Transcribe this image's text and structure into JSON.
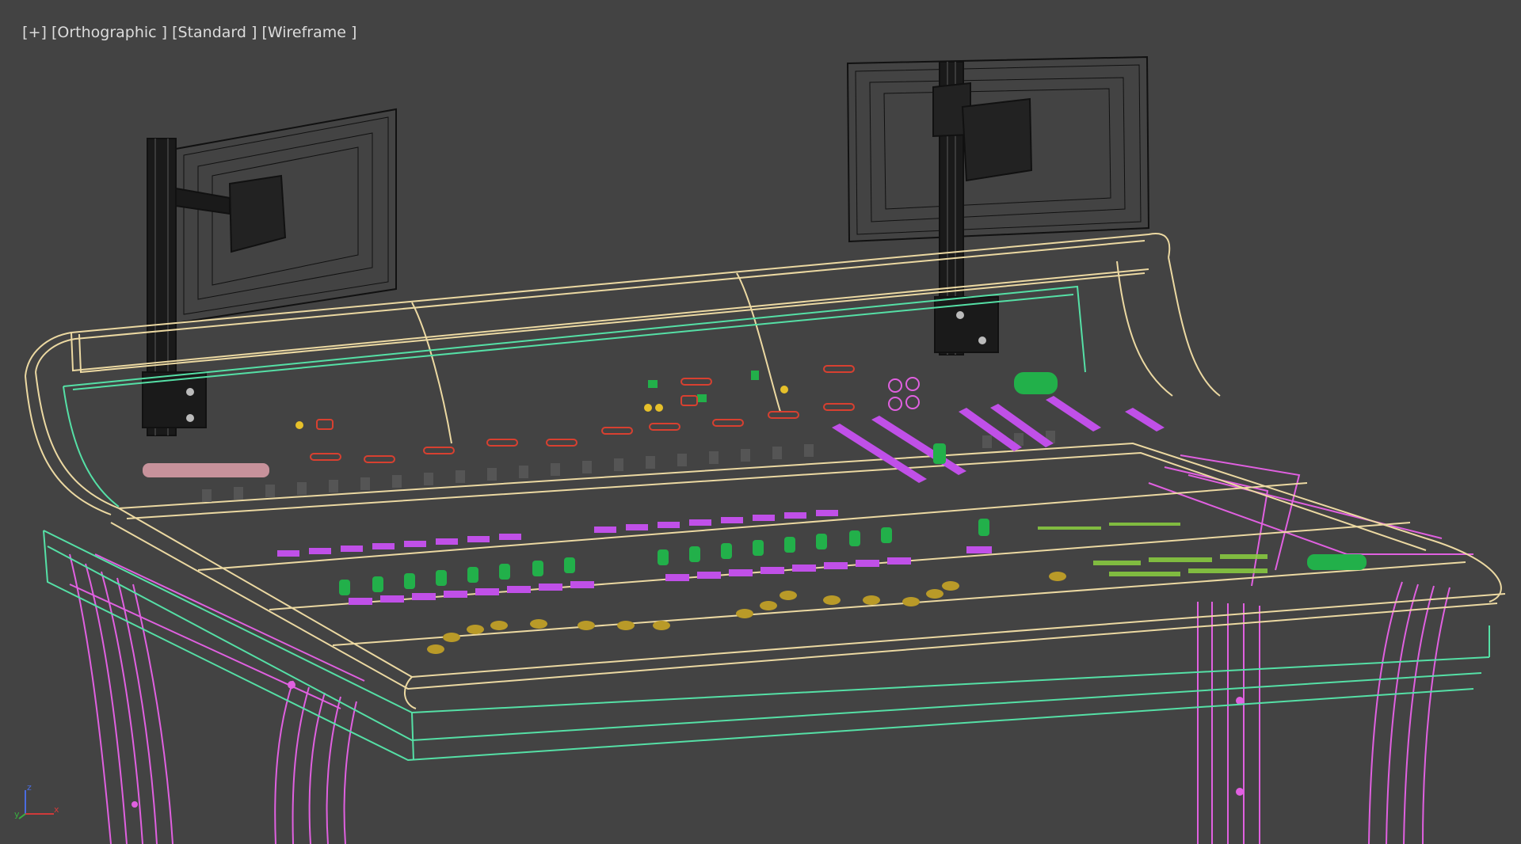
{
  "viewport": {
    "labels": {
      "plus": "[+]",
      "view_mode": "[Orthographic ]",
      "shading_mode": "[Standard ]",
      "display_mode": "[Wireframe ]"
    },
    "axis_gizmo": {
      "x": "x",
      "y": "y",
      "z": "z"
    }
  },
  "scene": {
    "objects": [
      "monitor-left",
      "monitor-right",
      "mixing-console",
      "console-legs"
    ],
    "colors": {
      "background": "#434343",
      "console_frame": "#ecd9a2",
      "console_trim": "#55e0a6",
      "legs": "#e060e0",
      "monitors": "#111111",
      "faders_green": "#22b04a",
      "faders_gray": "#555555",
      "fader_caps_violet": "#c050e8",
      "faders_gold": "#b99a28",
      "connectors_red": "#d84030",
      "markers_yellow": "#e6c02a"
    }
  }
}
